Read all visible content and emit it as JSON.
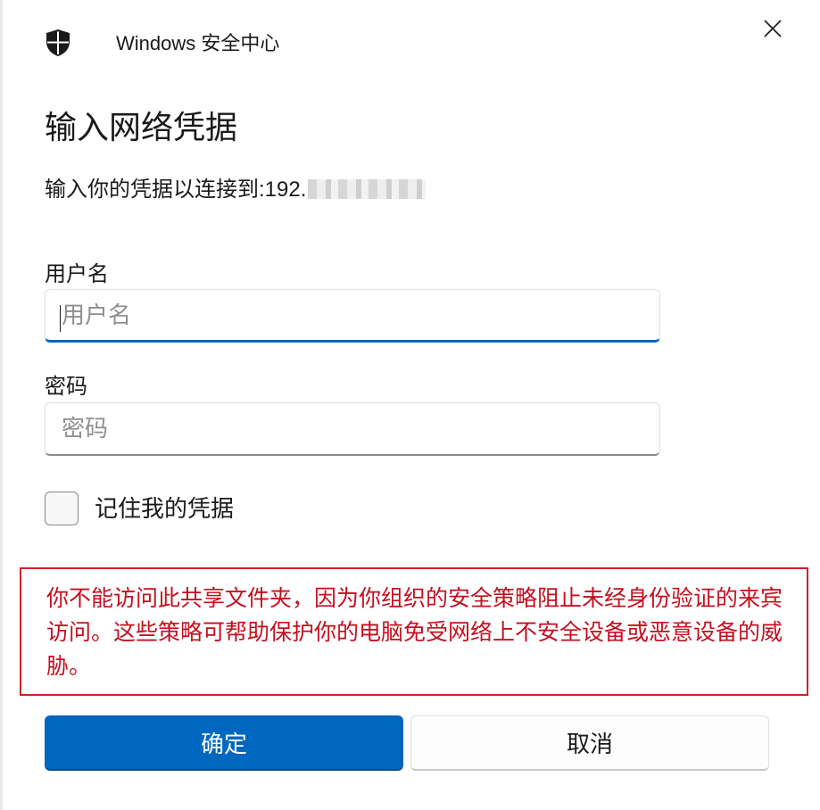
{
  "window": {
    "app_title": "Windows 安全中心",
    "app_icon": "shield-icon",
    "close_icon": "close-icon"
  },
  "dialog": {
    "heading": "输入网络凭据",
    "subtitle_prefix": "输入你的凭据以连接到:",
    "subtitle_visible_host": "192."
  },
  "username": {
    "label": "用户名",
    "placeholder": "用户名",
    "value": ""
  },
  "password": {
    "label": "密码",
    "placeholder": "密码",
    "value": ""
  },
  "remember": {
    "label": "记住我的凭据",
    "checked": false
  },
  "warning": {
    "text": "你不能访问此共享文件夹，因为你组织的安全策略阻止未经身份验证的来宾访问。这些策略可帮助保护你的电脑免受网络上不安全设备或恶意设备的威胁。"
  },
  "buttons": {
    "ok_label": "确定",
    "cancel_label": "取消"
  },
  "colors": {
    "accent": "#0067c0",
    "warning": "#c50f1f",
    "warning_border": "#d0202b"
  }
}
